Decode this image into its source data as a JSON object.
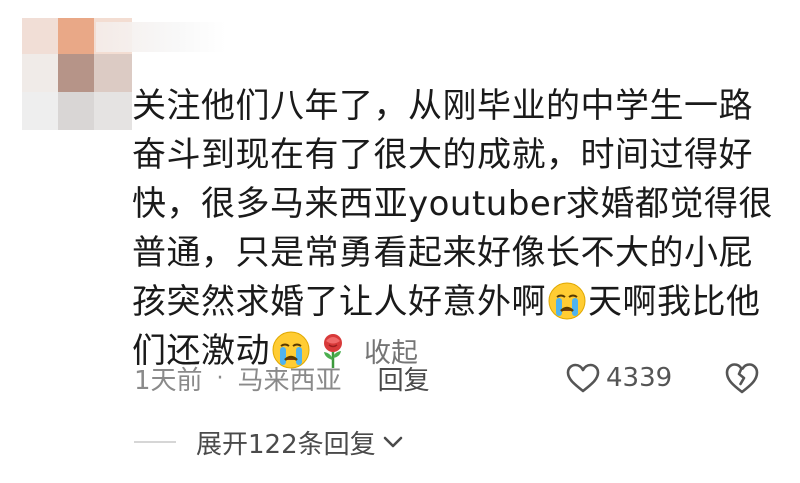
{
  "comment": {
    "lines": [
      "关注他们八年了，从刚毕业的中学生一路",
      "奋斗到现在有了很大的成就，时间过得好",
      "快，很多马来西亚youtuber求婚都觉得很",
      "普通，只是常勇看起来好像长不大的小屁",
      "孩突然求婚了让人好意外啊",
      "天啊我比他",
      "们还激动"
    ],
    "collapse_label": "收起"
  },
  "meta": {
    "time": "1天前",
    "separator": "·",
    "location": "马来西亚",
    "reply_label": "回复"
  },
  "likes": {
    "count": "4339"
  },
  "replies": {
    "expand_label": "展开122条回复"
  },
  "icons": {
    "cry": "crying-face-icon",
    "rose": "wilted-rose-icon",
    "like": "heart-outline-icon",
    "dislike": "broken-heart-icon",
    "expand": "chevron-down-icon"
  }
}
